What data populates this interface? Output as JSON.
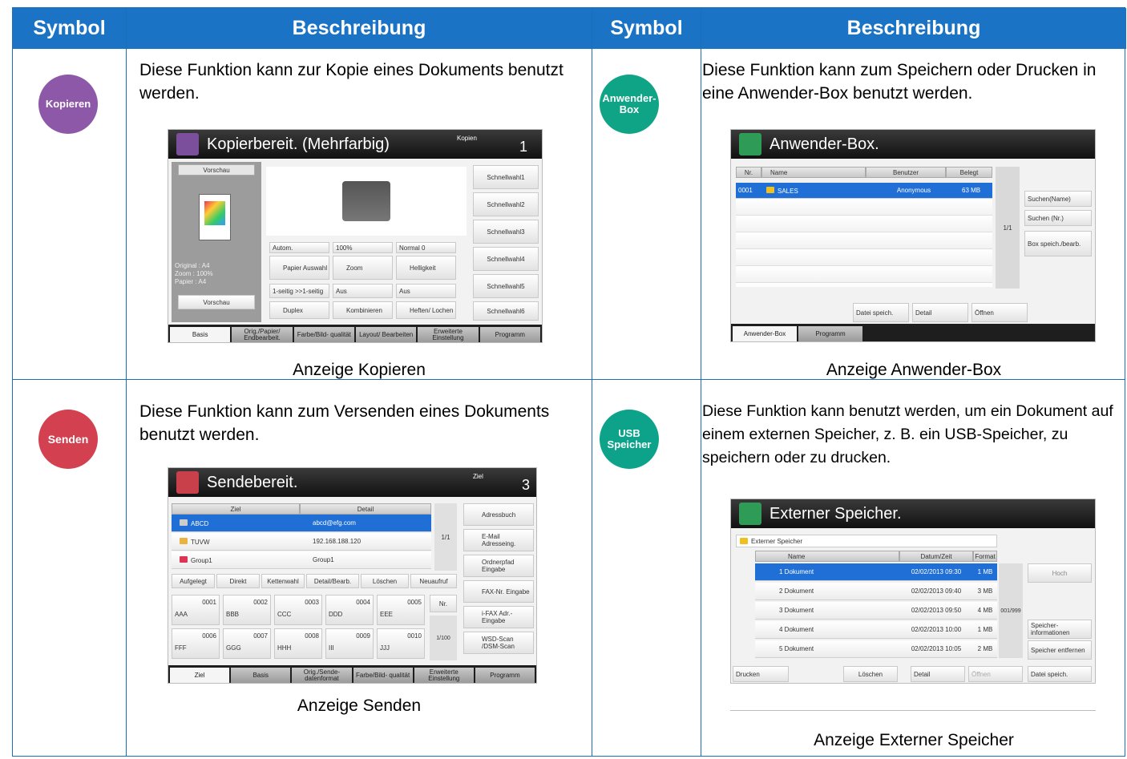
{
  "header": {
    "col1": "Symbol",
    "col2": "Beschreibung",
    "col3": "Symbol",
    "col4": "Beschreibung"
  },
  "colors": {
    "header_bg": "#1a73c4",
    "kopieren": "#8e58a8",
    "anwender_box": "#10a487",
    "senden": "#d34050",
    "usb": "#0ca38a"
  },
  "cells": [
    {
      "icon_label": "Kopieren",
      "description": "Diese Funktion kann zur Kopie eines Dokuments benutzt werden.",
      "caption": "Anzeige Kopieren",
      "screen": {
        "title": "Kopierbereit. (Mehrfarbig)",
        "counter_label": "Kopien",
        "counter_value": "1",
        "preview_header": "Vorschau",
        "info": [
          "Original  :  A4",
          "Zoom  :  100%",
          "Papier  :  A4"
        ],
        "preview_button": "Vorschau",
        "quick": [
          "Schnellwahl1",
          "Schnellwahl2",
          "Schnellwahl3",
          "Schnellwahl4",
          "Schnellwahl5",
          "Schnellwahl6"
        ],
        "status": [
          "Autom.",
          "100%",
          "Normal 0"
        ],
        "funcs": [
          "Papier Auswahl",
          "Zoom",
          "Helligkeit"
        ],
        "status2": [
          "1-seitig >>1-seitig",
          "Aus",
          "Aus"
        ],
        "funcs2": [
          "Duplex",
          "Kombinieren",
          "Heften/ Lochen"
        ],
        "tabs": [
          "Basis",
          "Orig./Papier/ Endbearbeit.",
          "Farbe/Bild- qualität",
          "Layout/ Bearbeiten",
          "Erweiterte Einstellung",
          "Programm"
        ]
      }
    },
    {
      "icon_label": "Anwender-Box",
      "description": "Diese Funktion kann zum Speichern oder Drucken in eine Anwender-Box benutzt werden.",
      "caption": "Anzeige Anwender-Box",
      "screen": {
        "title": "Anwender-Box.",
        "columns": [
          "Nr.",
          "Name",
          "Benutzer",
          "Belegt"
        ],
        "row": {
          "nr": "0001",
          "name": "SALES",
          "user": "Anonymous",
          "used": "63 MB"
        },
        "page": "1/1",
        "side": [
          "Suchen(Name)",
          "Suchen (Nr.)",
          "Box speich./bearb."
        ],
        "bottom": [
          "Datei speich.",
          "Detail",
          "Öffnen"
        ],
        "tabs": [
          "Anwender-Box",
          "Programm"
        ]
      }
    },
    {
      "icon_label": "Senden",
      "description": "Diese Funktion kann zum Versenden eines Dokuments benutzt werden.",
      "caption": "Anzeige Senden",
      "screen": {
        "title": "Sendebereit.",
        "counter_label": "Ziel",
        "counter_value": "3",
        "columns": [
          "Ziel",
          "Detail"
        ],
        "rows": [
          {
            "name": "ABCD",
            "detail": "abcd@efg.com"
          },
          {
            "name": "TUVW",
            "detail": "192.168.188.120"
          },
          {
            "name": "Group1",
            "detail": "Group1"
          }
        ],
        "page": "1/1",
        "actions": [
          "Aufgelegt",
          "Direkt",
          "Kettenwahl",
          "Detail/Bearb.",
          "Löschen",
          "Neuaufruf"
        ],
        "side": [
          "Adressbuch",
          "E-Mail Adresseing.",
          "Ordnerpfad Eingabe",
          "FAX-Nr. Eingabe",
          "i-FAX Adr.-Eingabe",
          "WSD-Scan /DSM-Scan"
        ],
        "speed": [
          {
            "num": "0001",
            "name": "AAA"
          },
          {
            "num": "0002",
            "name": "BBB"
          },
          {
            "num": "0003",
            "name": "CCC"
          },
          {
            "num": "0004",
            "name": "DDD"
          },
          {
            "num": "0005",
            "name": "EEE"
          },
          {
            "num": "0006",
            "name": "FFF"
          },
          {
            "num": "0007",
            "name": "GGG"
          },
          {
            "num": "0008",
            "name": "HHH"
          },
          {
            "num": "0009",
            "name": "III"
          },
          {
            "num": "0010",
            "name": "JJJ"
          }
        ],
        "nr_label": "Nr.",
        "speed_page": "1/100",
        "tabs": [
          "Ziel",
          "Basis",
          "Orig./Sende- datenformat",
          "Farbe/Bild- qualität",
          "Erweiterte Einstellung",
          "Programm"
        ]
      }
    },
    {
      "icon_label": "USB Speicher",
      "description": "Diese Funktion kann benutzt werden, um ein Dokument auf einem externen Speicher, z. B. ein USB-Speicher, zu speichern oder zu drucken.",
      "caption": "Anzeige Externer Speicher",
      "screen": {
        "title": "Externer Speicher.",
        "path": "Externer Speicher",
        "columns": [
          "Name",
          "Datum/Zeit",
          "Format"
        ],
        "rows": [
          {
            "name": "1  Dokument",
            "date": "02/02/2013 09:30",
            "size": "1 MB"
          },
          {
            "name": "2  Dokument",
            "date": "02/02/2013 09:40",
            "size": "3 MB"
          },
          {
            "name": "3  Dokument",
            "date": "02/02/2013 09:50",
            "size": "4 MB"
          },
          {
            "name": "4  Dokument",
            "date": "02/02/2013 10:00",
            "size": "1 MB"
          },
          {
            "name": "5  Dokument",
            "date": "02/02/2013 10:05",
            "size": "2 MB"
          }
        ],
        "page": "001/999",
        "side": [
          "Hoch",
          "Speicher- informationen",
          "Speicher entfernen"
        ],
        "bottom": [
          "Drucken",
          "Löschen",
          "Detail",
          "Öffnen",
          "Datei speich."
        ]
      }
    }
  ]
}
